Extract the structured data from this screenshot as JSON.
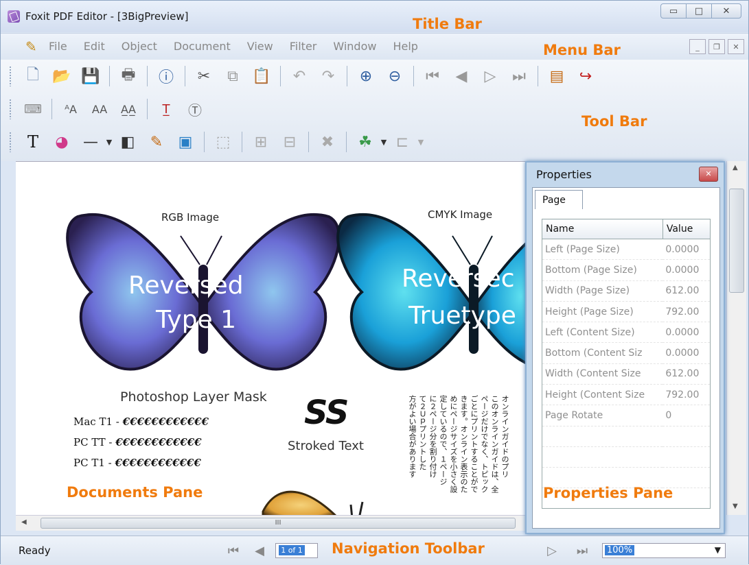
{
  "window": {
    "title": "Foxit PDF Editor - [3BigPreview]",
    "min_glyph": "▭",
    "max_glyph": "□",
    "close_glyph": "✕"
  },
  "menu": {
    "items": [
      "File",
      "Edit",
      "Object",
      "Document",
      "View",
      "Filter",
      "Window",
      "Help"
    ]
  },
  "annotations": {
    "title_bar": "Title Bar",
    "menu_bar": "Menu Bar",
    "tool_bar": "Tool Bar",
    "documents_pane": "Documents Pane",
    "properties_pane": "Properties Pane",
    "navigation_toolbar": "Navigation Toolbar"
  },
  "document": {
    "rgb_label": "RGB Image",
    "cmyk_label": "CMYK Image",
    "reversed1": "Reversed",
    "type1": "Type 1",
    "reversed2": "Reversec",
    "truetype": "Truetype",
    "mask_label": "Photoshop Layer Mask",
    "line1_label": "Mac T1 -",
    "line1_glyphs": "€€€€€€€€€€€€",
    "line2_label": "PC TT -",
    "line2_glyphs": "€€€€€€€€€€€€",
    "line3_label": "PC T1 -",
    "line3_glyphs": "€€€€€€€€€€€€",
    "ss_label": "SS",
    "stroked_label": "Stroked Text",
    "jp_columns": [
      "オンラインガイドのプリ",
      "このオンラインガイドは、全",
      "ページだけでなく、トピック",
      "ごとにプリントすることがで",
      "きます。オンライン表示のた",
      "めにページサイズを小さく設",
      "定しているので、１ページ",
      "に２ページ分を割り付け",
      "て２Ｕｐプリントした",
      "方がよい場合があります"
    ]
  },
  "properties": {
    "title": "Properties",
    "tab": "Page",
    "col_name": "Name",
    "col_value": "Value",
    "rows": [
      {
        "name": "Left (Page Size)",
        "value": "0.0000"
      },
      {
        "name": "Bottom (Page Size)",
        "value": "0.0000"
      },
      {
        "name": "Width (Page Size)",
        "value": "612.00"
      },
      {
        "name": "Height (Page Size)",
        "value": "792.00"
      },
      {
        "name": "Left (Content Size)",
        "value": "0.0000"
      },
      {
        "name": "Bottom (Content Siz",
        "value": "0.0000"
      },
      {
        "name": "Width (Content Size",
        "value": "612.00"
      },
      {
        "name": "Height (Content Size",
        "value": "792.00"
      },
      {
        "name": "Page Rotate",
        "value": "0"
      }
    ]
  },
  "status": {
    "text": "Ready",
    "page": "1 of 1",
    "zoom": "100%",
    "scroll_mark": "III"
  }
}
